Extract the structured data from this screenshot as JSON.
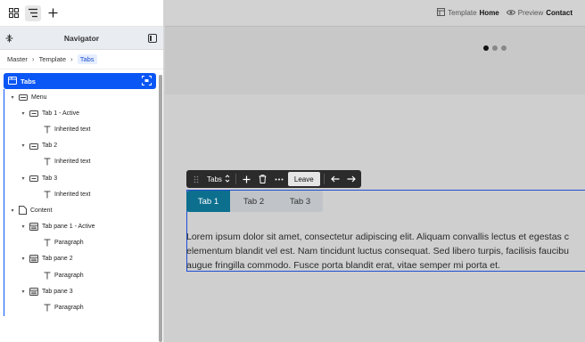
{
  "navigator": {
    "title": "Navigator",
    "breadcrumbs": [
      "Master",
      "Template",
      "Tabs"
    ],
    "selected": "Tabs",
    "tree": [
      {
        "label": "Menu",
        "indent": 1,
        "caret": true,
        "icon": "folder-icon"
      },
      {
        "label": "Tab 1 - Active",
        "indent": 2,
        "caret": true,
        "icon": "tab-icon"
      },
      {
        "label": "Inherited text",
        "indent": 3,
        "caret": false,
        "icon": "text-icon"
      },
      {
        "label": "Tab 2",
        "indent": 2,
        "caret": true,
        "icon": "tab-icon"
      },
      {
        "label": "Inherited text",
        "indent": 3,
        "caret": false,
        "icon": "text-icon"
      },
      {
        "label": "Tab 3",
        "indent": 2,
        "caret": true,
        "icon": "tab-icon"
      },
      {
        "label": "Inherited text",
        "indent": 3,
        "caret": false,
        "icon": "text-icon"
      },
      {
        "label": "Content",
        "indent": 1,
        "caret": true,
        "icon": "page-icon"
      },
      {
        "label": "Tab pane 1 - Active",
        "indent": 2,
        "caret": true,
        "icon": "pane-icon"
      },
      {
        "label": "Paragraph",
        "indent": 3,
        "caret": false,
        "icon": "text-icon"
      },
      {
        "label": "Tab pane 2",
        "indent": 2,
        "caret": true,
        "icon": "pane-icon"
      },
      {
        "label": "Paragraph",
        "indent": 3,
        "caret": false,
        "icon": "text-icon"
      },
      {
        "label": "Tab pane 3",
        "indent": 2,
        "caret": true,
        "icon": "pane-icon"
      },
      {
        "label": "Paragraph",
        "indent": 3,
        "caret": false,
        "icon": "text-icon"
      }
    ]
  },
  "canvas_top": {
    "template_prefix": "Template",
    "template_name": "Home",
    "preview_prefix": "Preview",
    "preview_name": "Contact"
  },
  "element_toolbar": {
    "element_name": "Tabs",
    "leave_label": "Leave"
  },
  "tabs": [
    "Tab 1",
    "Tab 2",
    "Tab 3"
  ],
  "paragraph_lines": [
    "Lorem ipsum dolor sit amet, consectetur adipiscing elit. Aliquam convallis lectus et egestas c",
    "elementum blandit vel est. Nam tincidunt luctus consequat. Sed libero turpis, facilisis faucibu",
    "augue fringilla commodo. Fusce porta blandit erat, vitae semper mi porta et."
  ],
  "colors": {
    "accent": "#0b57f5",
    "active_tab": "#0d6f8e"
  }
}
